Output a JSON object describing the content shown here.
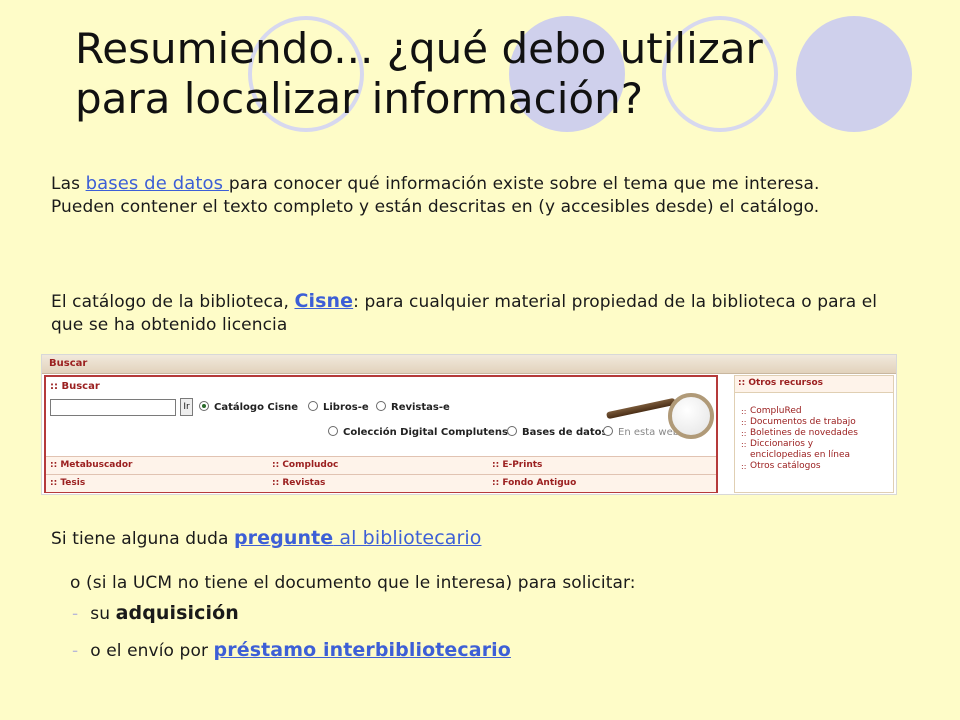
{
  "slide": {
    "title_line1": "Resumiendo... ¿qué debo utilizar",
    "title_line2": "para localizar información?"
  },
  "paragraph1": {
    "prefix": "Las ",
    "link": "bases de datos ",
    "suffix": "para conocer qué información existe sobre el tema que me interesa.",
    "line2": "Pueden contener el texto completo y están descritas en (y accesibles desde) el catálogo."
  },
  "paragraph2": {
    "prefix": "El catálogo de la biblioteca, ",
    "link": "Cisne",
    "suffix": ": para cualquier material propiedad de la biblioteca o para el que se ha obtenido licencia"
  },
  "search_panel": {
    "header": "Buscar",
    "title": ":: Buscar",
    "input_value": "",
    "go_label": "Ir",
    "radios_row1": [
      {
        "label": "Catálogo Cisne",
        "checked": true
      },
      {
        "label": "Libros-e",
        "checked": false
      },
      {
        "label": "Revistas-e",
        "checked": false
      }
    ],
    "radios_row2": [
      {
        "label": "Colección Digital Complutense",
        "checked": false
      },
      {
        "label": "Bases de datos",
        "checked": false
      },
      {
        "label": "En esta web",
        "checked": false
      }
    ],
    "links_row1": [
      ":: Metabuscador",
      ":: Compludoc",
      ":: E-Prints"
    ],
    "links_row2": [
      ":: Tesis",
      ":: Revistas",
      ":: Fondo Antiguo"
    ],
    "other_title": ":: Otros recursos",
    "other_items": [
      "CompluRed",
      "Documentos de trabajo",
      "Boletines de novedades",
      "Diccionarios y",
      "enciclopedias en línea",
      "Otros catálogos"
    ]
  },
  "paragraph3": {
    "prefix": "Si tiene alguna duda ",
    "link_bold": "pregunte",
    "link_rest": " al bibliotecario"
  },
  "paragraph4": {
    "text": "o (si la UCM no tiene el documento que le interesa) para solicitar:"
  },
  "bullets": {
    "dash": "-",
    "item1_prefix": "su ",
    "item1_bold": "adquisición",
    "item2_prefix": "o el envío por ",
    "item2_link": "préstamo interbibliotecario"
  },
  "colors": {
    "background": "#fefcc8",
    "circles": "#cfd0ec",
    "link": "#3d5fd6",
    "panel_accent": "#b53a3a"
  }
}
